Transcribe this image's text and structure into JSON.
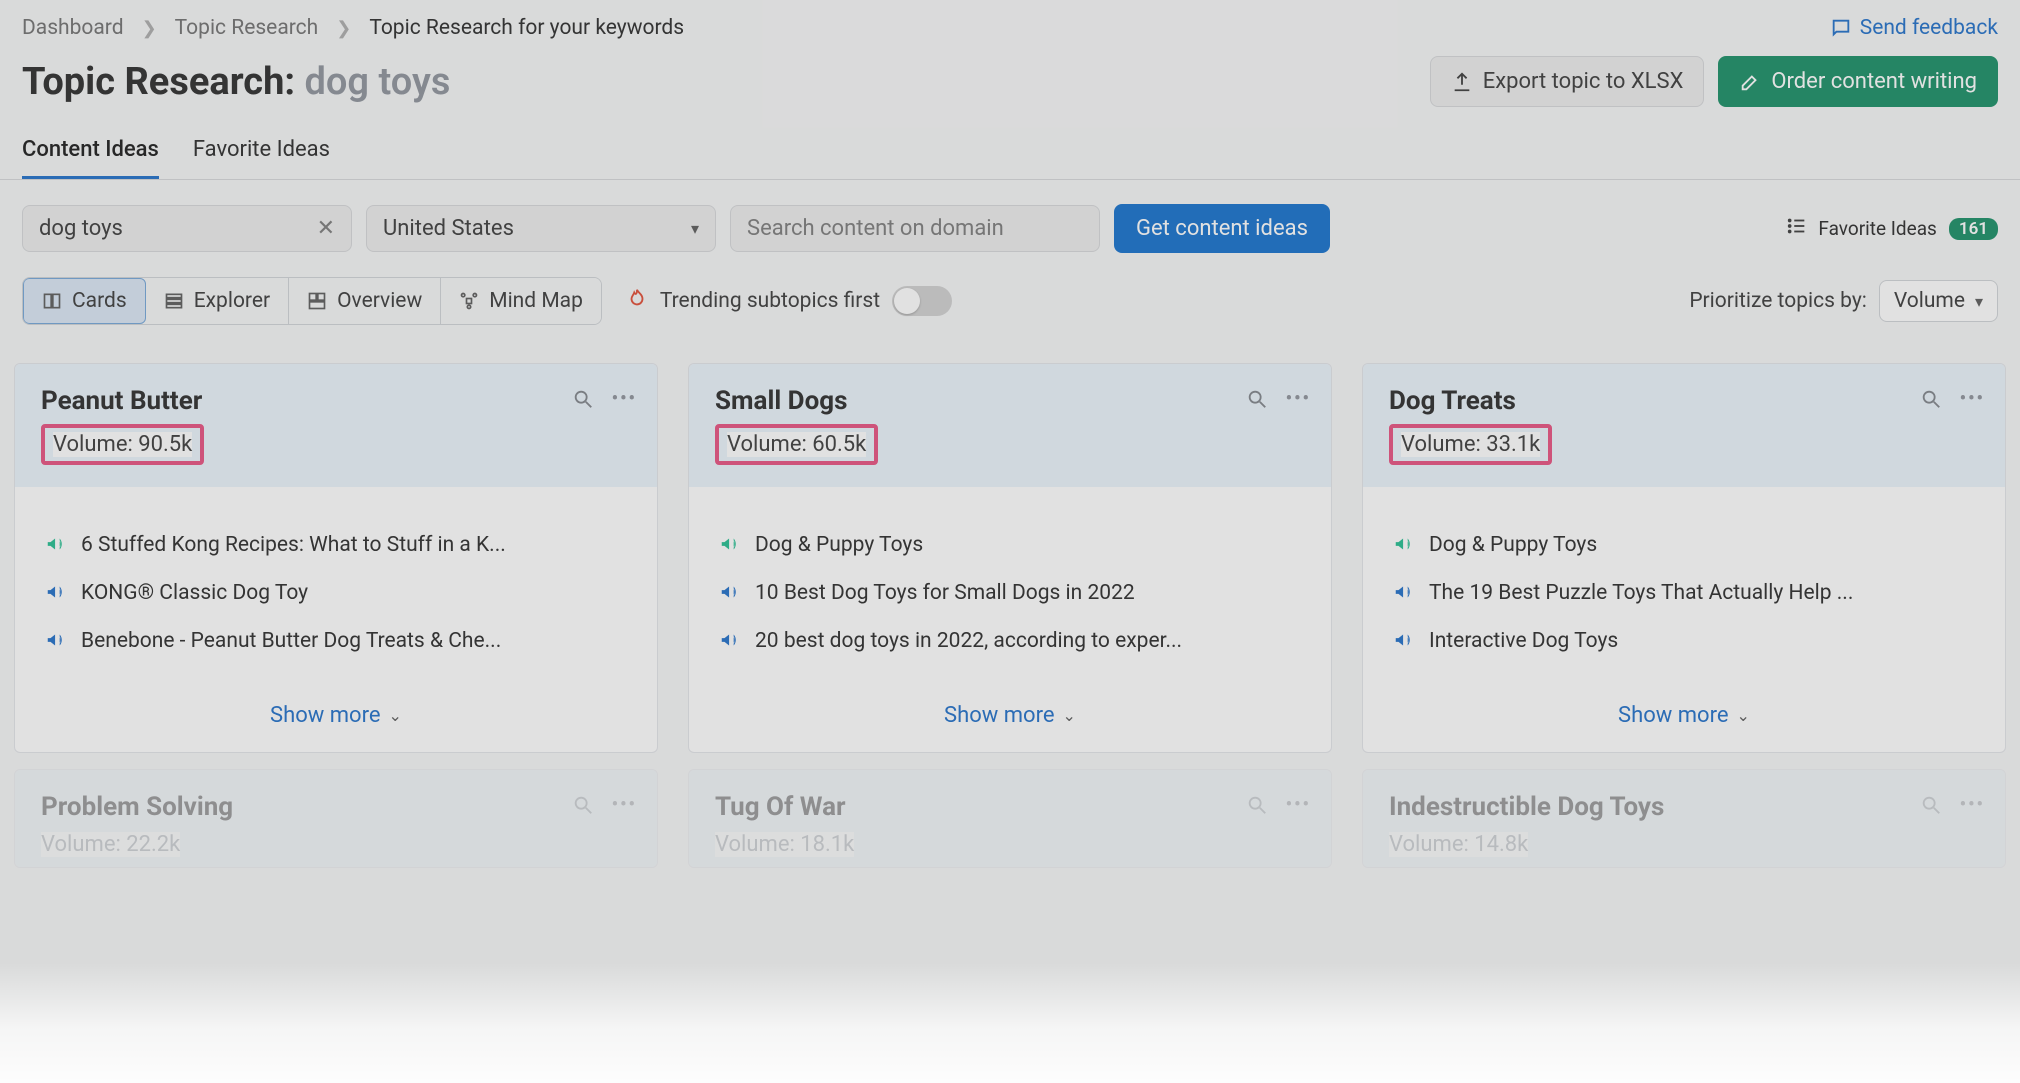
{
  "breadcrumbs": {
    "dashboard": "Dashboard",
    "topic_research": "Topic Research",
    "current": "Topic Research for your keywords"
  },
  "feedback_label": "Send feedback",
  "title": {
    "prefix": "Topic Research:",
    "query": "dog toys"
  },
  "actions": {
    "export": "Export topic to XLSX",
    "order": "Order content writing"
  },
  "tabs": {
    "content_ideas": "Content Ideas",
    "favorite_ideas": "Favorite Ideas"
  },
  "filters": {
    "keyword": "dog toys",
    "country": "United States",
    "domain_placeholder": "Search content on domain",
    "get_ideas": "Get content ideas",
    "fav_link": "Favorite Ideas",
    "fav_count": "161"
  },
  "views": {
    "cards": "Cards",
    "explorer": "Explorer",
    "overview": "Overview",
    "mindmap": "Mind Map",
    "trending": "Trending subtopics first",
    "prioritize_label": "Prioritize topics by:",
    "prioritize_value": "Volume"
  },
  "show_more": "Show more",
  "cards_row1": [
    {
      "title": "Peanut Butter",
      "volume": "Volume: 90.5k",
      "items": [
        {
          "color": "green",
          "text": "6 Stuffed Kong Recipes: What to Stuff in a K..."
        },
        {
          "color": "blue",
          "text": "KONG® Classic Dog Toy"
        },
        {
          "color": "blue",
          "text": "Benebone - Peanut Butter Dog Treats & Che..."
        }
      ]
    },
    {
      "title": "Small Dogs",
      "volume": "Volume: 60.5k",
      "items": [
        {
          "color": "green",
          "text": "Dog & Puppy Toys"
        },
        {
          "color": "blue",
          "text": "10 Best Dog Toys for Small Dogs in 2022"
        },
        {
          "color": "blue",
          "text": "20 best dog toys in 2022, according to exper..."
        }
      ]
    },
    {
      "title": "Dog Treats",
      "volume": "Volume: 33.1k",
      "items": [
        {
          "color": "green",
          "text": "Dog & Puppy Toys"
        },
        {
          "color": "blue",
          "text": "The 19 Best Puzzle Toys That Actually Help ..."
        },
        {
          "color": "blue",
          "text": "Interactive Dog Toys"
        }
      ]
    }
  ],
  "cards_row2": [
    {
      "title": "Problem Solving",
      "volume": "Volume: 22.2k"
    },
    {
      "title": "Tug Of War",
      "volume": "Volume: 18.1k"
    },
    {
      "title": "Indestructible Dog Toys",
      "volume": "Volume: 14.8k"
    }
  ]
}
